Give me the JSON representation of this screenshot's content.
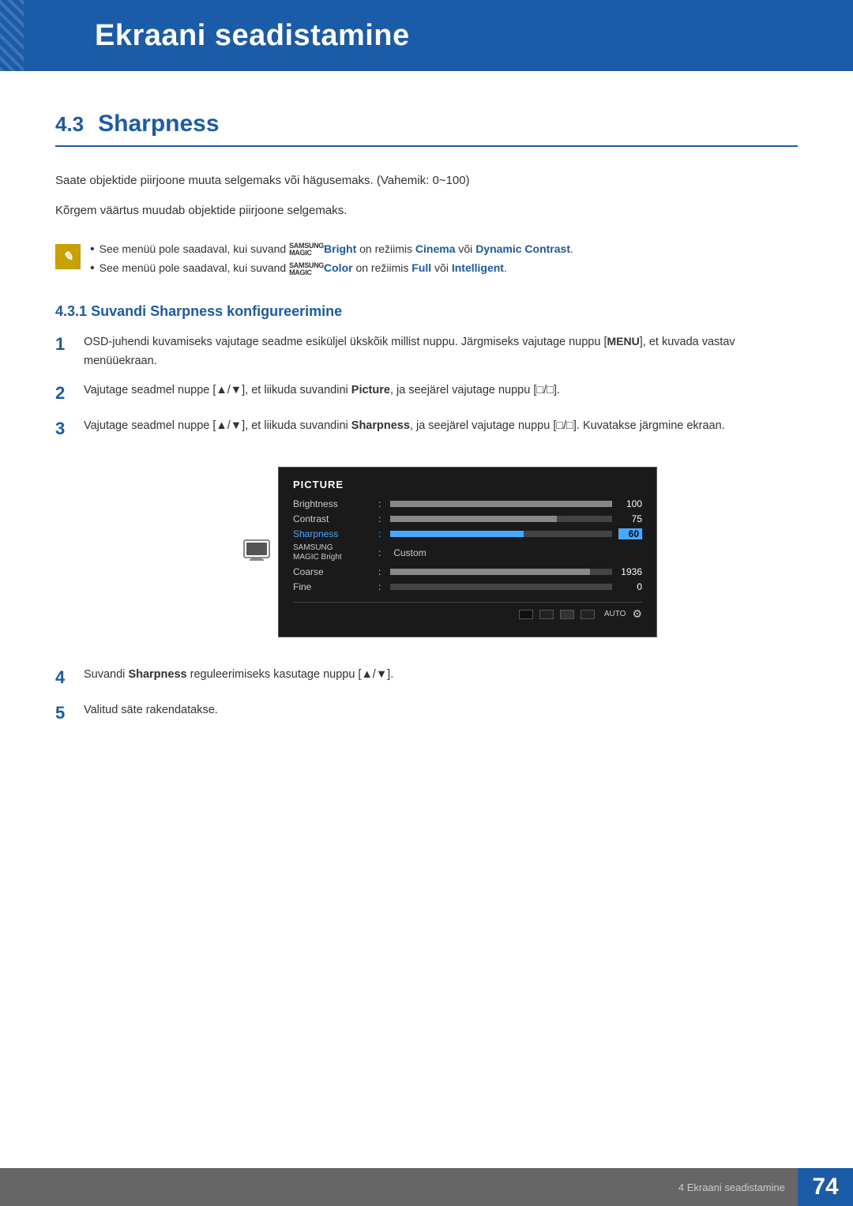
{
  "header": {
    "chapter_number": "4",
    "title": "Ekraani seadistamine"
  },
  "section": {
    "number": "4.3",
    "heading": "Sharpness"
  },
  "body_lines": [
    "Saate objektide piirjoone muuta selgemaks või hägusemaks. (Vahemik: 0~100)",
    "Kõrgem väärtus muudab objektide piirjoone selgemaks."
  ],
  "notes": [
    {
      "id": 1,
      "text_before": "See menüü pole saadaval, kui suvand ",
      "brand": "SAMSUNG MAGIC",
      "feature": "Bright",
      "text_middle": " on režiimis ",
      "highlight1": "Cinema",
      "text_join": " või ",
      "highlight2": "Dynamic Contrast",
      "text_end": "."
    },
    {
      "id": 2,
      "text_before": "See menüü pole saadaval, kui suvand ",
      "brand": "SAMSUNG MAGIC",
      "feature": "Color",
      "text_middle": " on režiimis ",
      "highlight1": "Full",
      "text_join": " või ",
      "highlight2": "Intelligent",
      "text_end": "."
    }
  ],
  "subsection": {
    "number": "4.3.1",
    "heading": "Suvandi Sharpness konfigureerimine"
  },
  "steps": [
    {
      "number": "1",
      "text": "OSD-juhendi kuvamiseks vajutage seadme esiküljel ükskõik millist nuppu. Järgmiseks vajutage nuppu [",
      "key": "MENU",
      "text2": "], et kuvada vastav menüüekraan."
    },
    {
      "number": "2",
      "text_before": "Vajutage seadmel nuppe [▲/▼], et liikuda suvandini ",
      "bold1": "Picture",
      "text_after": ", ja seejärel vajutage nuppu [□/□]."
    },
    {
      "number": "3",
      "text_before": "Vajutage seadmel nuppe [▲/▼], et liikuda suvandini ",
      "bold1": "Sharpness",
      "text_after": ", ja seejärel vajutage nuppu [□/□]. Kuvatakse järgmine ekraan."
    },
    {
      "number": "4",
      "text_before": "Suvandi ",
      "bold1": "Sharpness",
      "text_after": " reguleerimiseks kasutage nuppu [▲/▼]."
    },
    {
      "number": "5",
      "text": "Valitud säte rakendatakse."
    }
  ],
  "osd": {
    "title": "PICTURE",
    "rows": [
      {
        "label": "Brightness",
        "bar_pct": 100,
        "value": "100",
        "active": false
      },
      {
        "label": "Contrast",
        "bar_pct": 75,
        "value": "75",
        "active": false
      },
      {
        "label": "Sharpness",
        "bar_pct": 60,
        "value": "60",
        "active": true
      },
      {
        "label": "SAMSUNG MAGIC Bright",
        "bar_pct": 0,
        "value": "Custom",
        "is_custom": true,
        "active": false
      },
      {
        "label": "Coarse",
        "bar_pct": 90,
        "value": "1936",
        "active": false
      },
      {
        "label": "Fine",
        "bar_pct": 0,
        "value": "0",
        "active": false
      }
    ]
  },
  "footer": {
    "chapter_label": "4 Ekraani seadistamine",
    "page_number": "74"
  }
}
